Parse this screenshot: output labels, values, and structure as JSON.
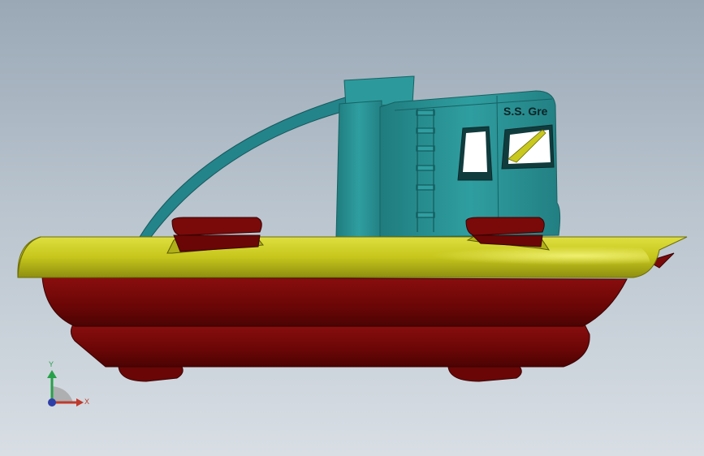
{
  "model": {
    "hull_name": "S.S. Gre",
    "colors": {
      "background_top": "#9aa8b6",
      "background_bottom": "#d8dee4",
      "cabin": "#2a8f91",
      "cabin_dark": "#1d6f72",
      "deck": "#c8c81e",
      "deck_dark": "#9a9a12",
      "hull": "#7a0a0a",
      "hull_dark": "#520404"
    }
  },
  "triad": {
    "x_label": "X",
    "y_label": "Y",
    "colors": {
      "x": "#c0392b",
      "y": "#27a04a",
      "z": "#2e3ea8"
    }
  }
}
